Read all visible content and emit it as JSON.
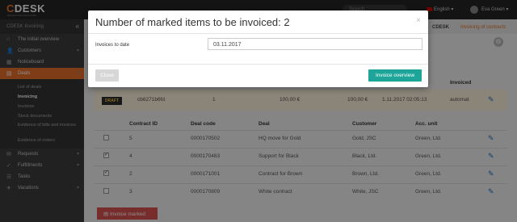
{
  "app": {
    "logo": "DESK",
    "logo_prefix": "C",
    "logo_sub": "Business with better profits"
  },
  "header": {
    "search_placeholder": "Search",
    "language": "English",
    "user": "Eva Green"
  },
  "sidebar": {
    "section": "CDESK Invoicing",
    "items": [
      {
        "label": "The initial overview",
        "icon": "⌂"
      },
      {
        "label": "Customers",
        "icon": "👤"
      },
      {
        "label": "Noticeboard",
        "icon": "▦"
      },
      {
        "label": "Deals",
        "icon": "▤"
      }
    ],
    "subitems": [
      "List of deals",
      "Invoicing",
      "Invoices",
      "Stock documents",
      "Evidence of bills and invoices",
      "Evidence of orders"
    ],
    "items_bottom": [
      {
        "label": "Requests",
        "icon": "✉"
      },
      {
        "label": "Fulfillments",
        "icon": "✓"
      },
      {
        "label": "Tasks",
        "icon": "☰"
      },
      {
        "label": "Vacations",
        "icon": "✈"
      }
    ]
  },
  "breadcrumb": {
    "first": "CDESK",
    "second": "Invoicing of contracts"
  },
  "draft_table": {
    "col_invoiced": "Invoiced",
    "row": {
      "badge": "DRAFT",
      "code": "cb6271b6fd",
      "num": "1",
      "amount": "100,00 €",
      "amount2": "100,00 €",
      "date": "1.11.2017 02:05:13",
      "invoiced": "automat"
    }
  },
  "contracts_table": {
    "headers": [
      "Contract ID",
      "Deal code",
      "Deal",
      "Customer",
      "Acc. unit"
    ],
    "rows": [
      {
        "checked": false,
        "id": "5",
        "code": "0000170502",
        "deal": "HQ move for Gold",
        "customer": "Gold, JSC",
        "unit": "Green, Ltd."
      },
      {
        "checked": true,
        "id": "4",
        "code": "0000170483",
        "deal": "Support for Black",
        "customer": "Black, Ltd.",
        "unit": "Green, Ltd."
      },
      {
        "checked": true,
        "id": "2",
        "code": "0000171001",
        "deal": "Contract for Brown",
        "customer": "Brown, Ltd.",
        "unit": "Green, Ltd."
      },
      {
        "checked": false,
        "id": "3",
        "code": "0000170809",
        "deal": "White contract",
        "customer": "White, JSC",
        "unit": "Green, Ltd."
      }
    ]
  },
  "invoice_marked_button": "Invoice marked",
  "modal": {
    "title": "Number of marked items to be invoiced: 2",
    "date_label": "Invoices to date",
    "date_value": "03.11.2017",
    "close_label": "Close",
    "overview_label": "Invoice overview"
  }
}
